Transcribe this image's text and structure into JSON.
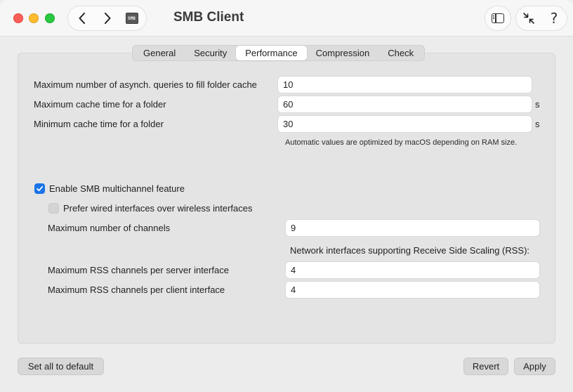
{
  "window": {
    "title": "SMB Client",
    "smb_icon_text": "SMB"
  },
  "tabs": [
    {
      "label": "General",
      "active": false
    },
    {
      "label": "Security",
      "active": false
    },
    {
      "label": "Performance",
      "active": true
    },
    {
      "label": "Compression",
      "active": false
    },
    {
      "label": "Check",
      "active": false
    }
  ],
  "folder_cache": {
    "async_queries_label": "Maximum number of asynch. queries to fill folder cache",
    "async_queries_value": "10",
    "max_cache_time_label": "Maximum cache time for a folder",
    "max_cache_time_value": "60",
    "max_cache_time_unit": "s",
    "min_cache_time_label": "Minimum cache time for a folder",
    "min_cache_time_value": "30",
    "min_cache_time_unit": "s",
    "note": "Automatic values are optimized by macOS depending on RAM size."
  },
  "multichannel": {
    "enable_label": "Enable SMB multichannel feature",
    "enable_checked": true,
    "prefer_wired_label": "Prefer wired interfaces over wireless interfaces",
    "prefer_wired_checked": false,
    "max_channels_label": "Maximum number of channels",
    "max_channels_value": "9",
    "rss_heading": "Network interfaces supporting Receive Side Scaling (RSS):",
    "rss_server_label": "Maximum RSS channels per server interface",
    "rss_server_value": "4",
    "rss_client_label": "Maximum RSS channels per client interface",
    "rss_client_value": "4"
  },
  "footer": {
    "default_label": "Set all to default",
    "revert_label": "Revert",
    "apply_label": "Apply"
  },
  "colors": {
    "accent": "#1a73e8",
    "close": "#fe5f57",
    "minimize": "#febc2e",
    "zoom": "#28c840"
  }
}
